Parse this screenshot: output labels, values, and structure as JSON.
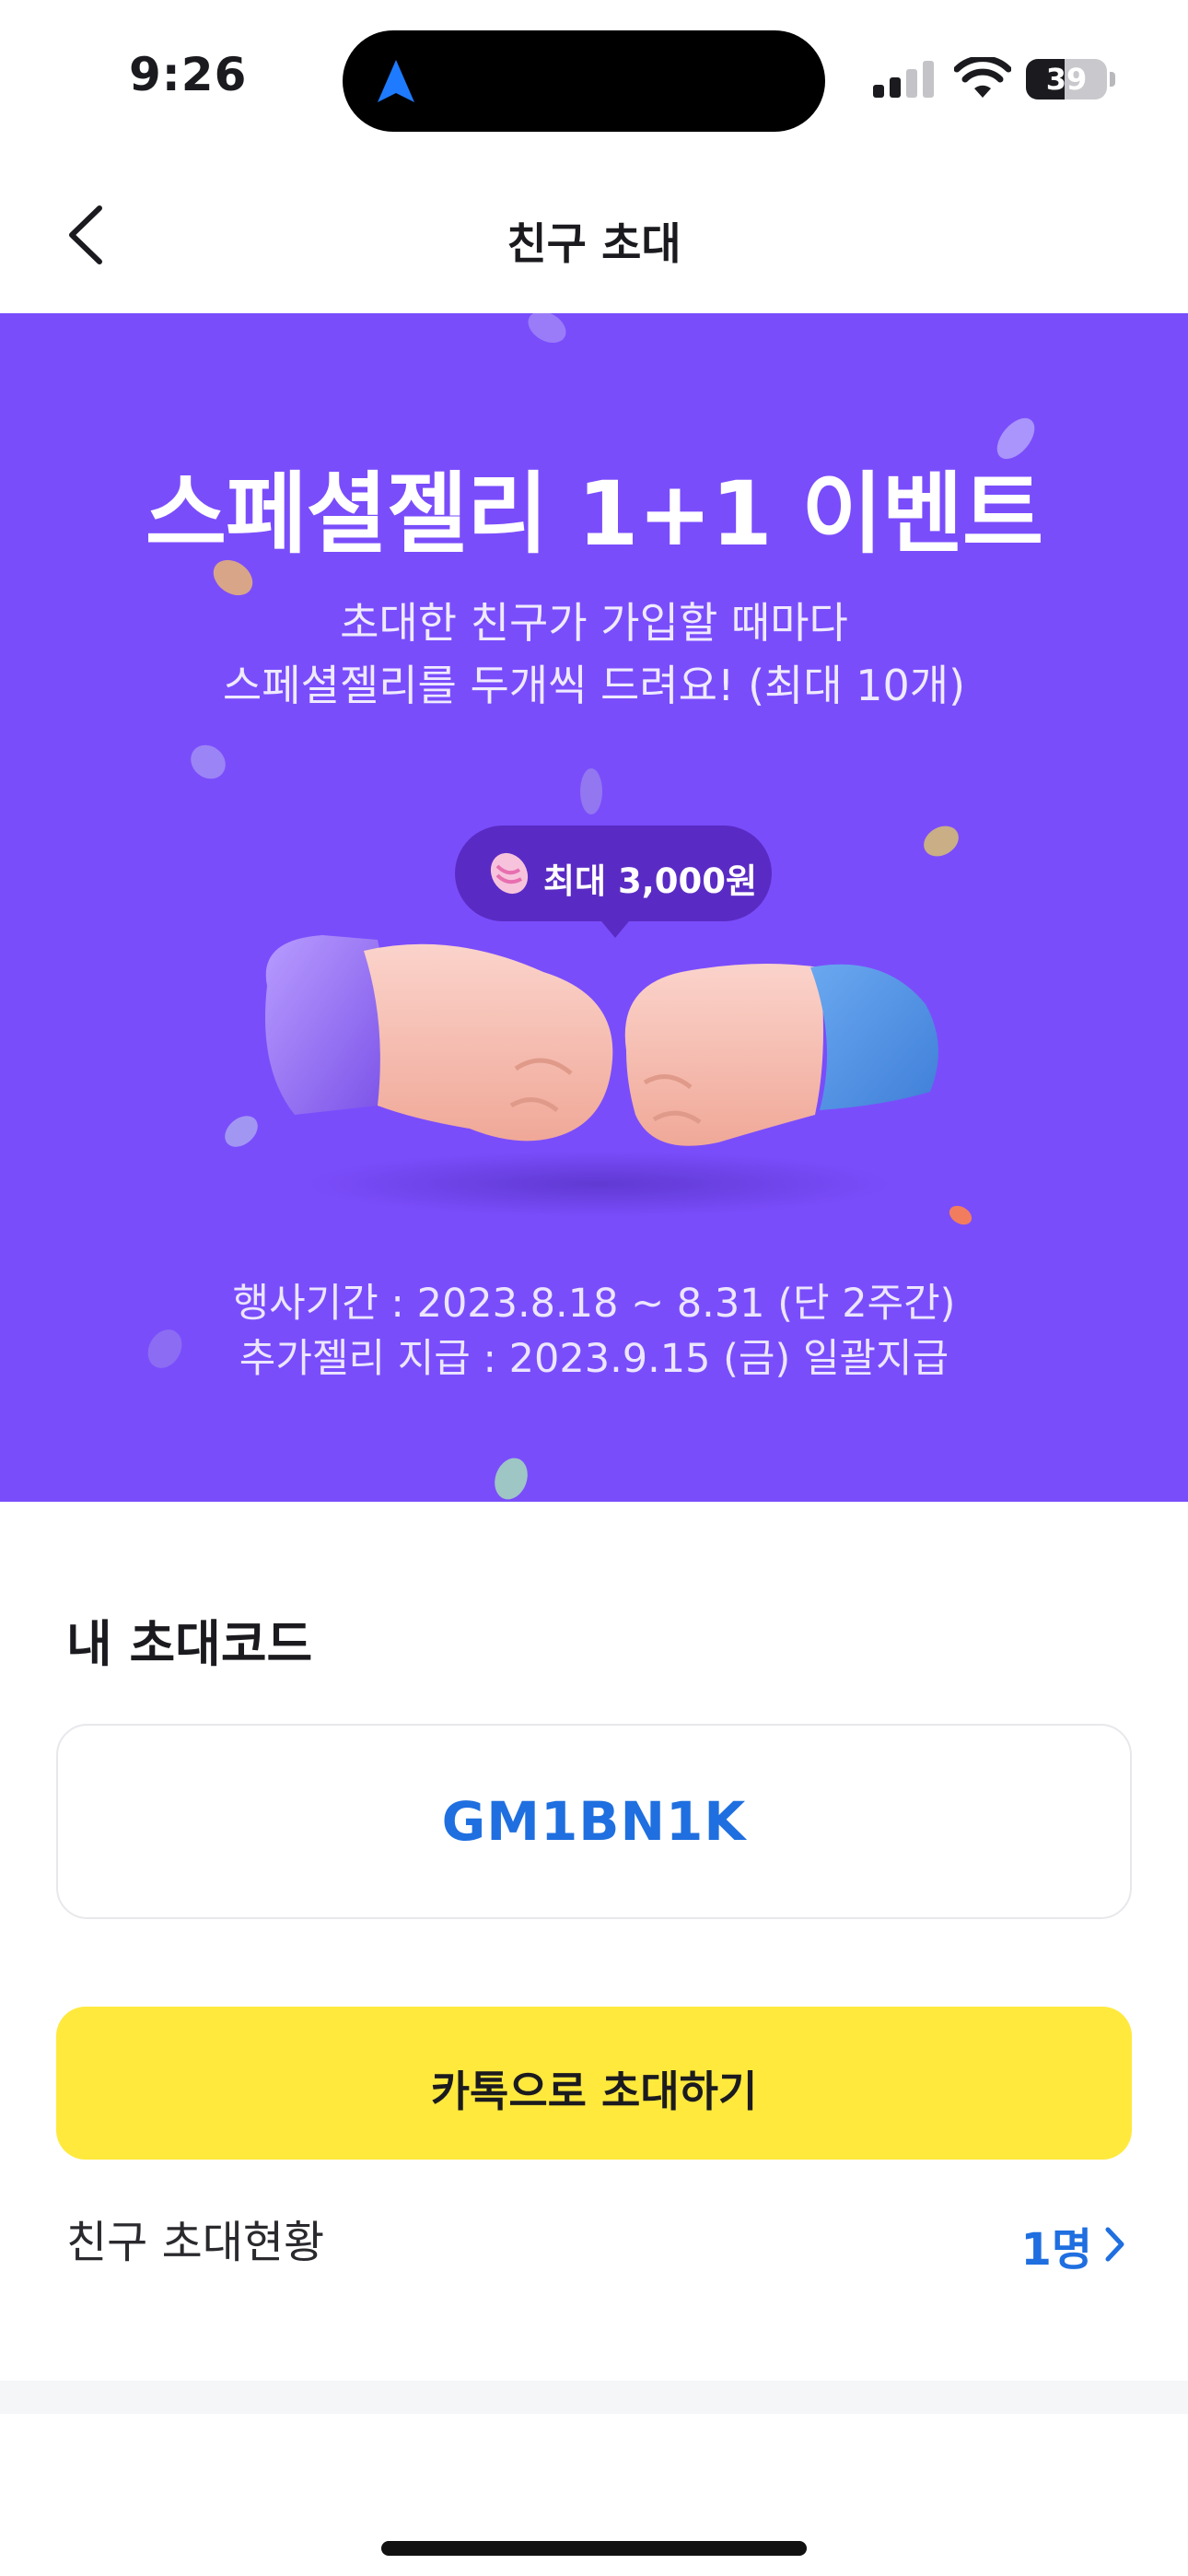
{
  "status_bar": {
    "time": "9:26",
    "battery": "39",
    "icons": [
      "location-arrow-icon",
      "signal-icon",
      "wifi-icon",
      "battery-icon"
    ]
  },
  "header": {
    "title": "친구 초대",
    "back_icon": "chevron-left-icon"
  },
  "banner": {
    "background_color": "#7a4dfb",
    "title": "스페셜젤리 1+1 이벤트",
    "subtitle_line1": "초대한 친구가 가입할 때마다",
    "subtitle_line2": "스페셜젤리를 두개씩 드려요! (최대 10개)",
    "bubble_text": "최대 3,000원",
    "bubble_icon": "jelly-bean-icon",
    "illustration": "fist-bump-illustration",
    "info_line1": "행사기간 : 2023.8.18 ~ 8.31 (단 2주간)",
    "info_line2": "추가젤리 지급 : 2023.9.15 (금) 일괄지급"
  },
  "invite_code": {
    "section_title": "내 초대코드",
    "code": "GM1BN1K",
    "code_color": "#1f6fe0"
  },
  "kakao_button": {
    "label": "카톡으로 초대하기",
    "color": "#ffe93d"
  },
  "invite_status": {
    "label": "친구 초대현황",
    "count": "1명",
    "chevron_icon": "chevron-right-icon"
  }
}
